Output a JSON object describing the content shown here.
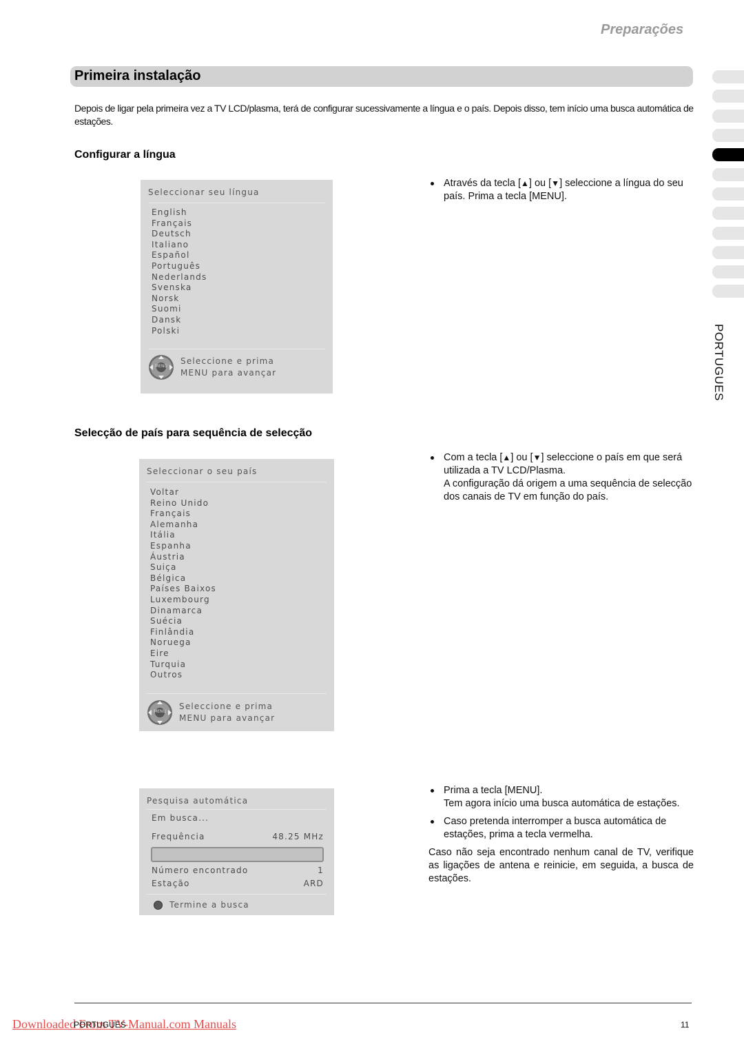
{
  "header": {
    "section_title": "Preparações",
    "page_title": "Primeira instalação"
  },
  "intro": "Depois de ligar pela primeira vez a TV LCD/plasma, terá de configurar sucessivamente a língua e o país. Depois disso, tem início uma busca automática de estações.",
  "side_index": {
    "tab_count": 12,
    "active_tab": 5,
    "language_label": "PORTUGUES"
  },
  "section_language": {
    "heading": "Configurar a língua",
    "osd": {
      "title": "Seleccionar seu língua",
      "items": [
        "English",
        "Français",
        "Deutsch",
        "Italiano",
        "Español",
        "Português",
        "Nederlands",
        "Svenska",
        "Norsk",
        "Suomi",
        "Dansk",
        "Polski"
      ],
      "footer_icon": "remote-dpad-menu-icon",
      "footer_line1": "Seleccione e prima",
      "footer_line2": "MENU para avançar"
    },
    "instructions": {
      "bullet1_a": "Através da tecla [",
      "up_key": "▲",
      "bullet1_b": "] ou [",
      "down_key": "▼",
      "bullet1_c": "] seleccione a língua do seu país. Prima a tecla [MENU]."
    }
  },
  "section_country": {
    "heading": "Selecção de país para sequência de selecção",
    "osd": {
      "title": "Seleccionar o seu país",
      "items": [
        "Voltar",
        "Reino Unido",
        "Français",
        "Alemanha",
        "Itália",
        "Espanha",
        "Áustria",
        "Suiça",
        "Bélgica",
        "Países Baixos",
        "Luxembourg",
        "Dinamarca",
        "Suécia",
        "Finlândia",
        "Noruega",
        "Eire",
        "Turquia",
        "Outros"
      ],
      "footer_icon": "remote-dpad-menu-icon",
      "footer_line1": "Seleccione e prima",
      "footer_line2": "MENU para avançar"
    },
    "instructions": {
      "bullet1_a": "Com a tecla [",
      "up_key": "▲",
      "bullet1_b": "] ou [",
      "down_key": "▼",
      "bullet1_c": "] seleccione o país em que será utilizada a TV LCD/Plasma.",
      "bullet1_d": "A configuração dá origem a uma sequência de selecção dos canais de TV em função do país."
    }
  },
  "section_search": {
    "osd": {
      "title": "Pesquisa automática",
      "status": "Em busca...",
      "frequency_label": "Frequência",
      "frequency_value": "48.25 MHz",
      "progress_percent": 0,
      "found_label": "Número encontrado",
      "found_value": "1",
      "station_label": "Estação",
      "station_value": "ARD",
      "stop_label": "Termine a busca",
      "stop_button_color": "#5a5a5a"
    },
    "instructions": {
      "bullet1_a": "Prima a tecla [MENU].",
      "bullet1_b": "Tem agora início uma busca automática de estações.",
      "bullet2": "Caso pretenda interromper a busca automática de estações, prima a tecla vermelha.",
      "note": "Caso não seja encontrado nenhum canal de TV, verifique as ligações de antena e reinicie, em seguida, a busca de estações."
    }
  },
  "footer": {
    "language": "PORTUGUES",
    "page_number": "11",
    "watermark": "Downloaded From TV-Manual.com Manuals",
    "watermark_color": "#e03030"
  }
}
